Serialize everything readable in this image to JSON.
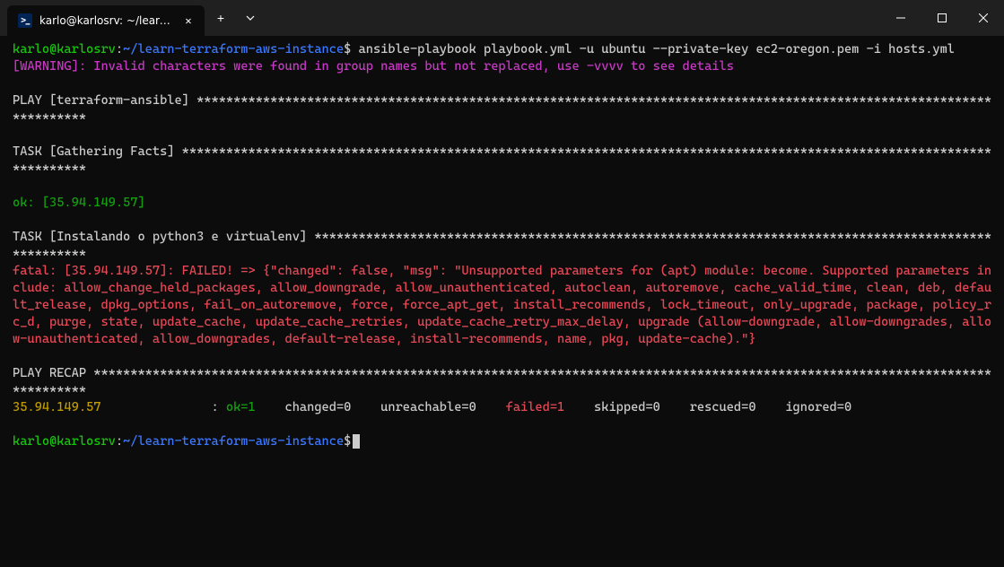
{
  "titlebar": {
    "tab_title": "karlo@karlosrv: ~/learn-terraf",
    "close_x": "✕",
    "plus": "+"
  },
  "prompt1": {
    "user_host": "karlo@karlosrv",
    "colon": ":",
    "path": "~/learn-terraform-aws-instance",
    "dollar": "$",
    "command": " ansible-playbook playbook.yml -u ubuntu --private-key ec2-oregon.pem -i hosts.yml"
  },
  "warning": {
    "tag": "[WARNING]",
    "msg": ": Invalid characters were found in group names but not replaced, use -vvvv to see details"
  },
  "play_header": "PLAY [terraform-ansible] ",
  "task1_header": "TASK [Gathering Facts] ",
  "ok_line": "ok: [35.94.149.57]",
  "task2_header": "TASK [Instalando o python3 e virtualenv] ",
  "fatal_msg": "fatal: [35.94.149.57]: FAILED! => {\"changed\": false, \"msg\": \"Unsupported parameters for (apt) module: become. Supported parameters include: allow_change_held_packages, allow_downgrade, allow_unauthenticated, autoclean, autoremove, cache_valid_time, clean, deb, default_release, dpkg_options, fail_on_autoremove, force, force_apt_get, install_recommends, lock_timeout, only_upgrade, package, policy_rc_d, purge, state, update_cache, update_cache_retries, update_cache_retry_max_delay, upgrade (allow-downgrade, allow-downgrades, allow-unauthenticated, allow_downgrades, default-release, install-recommends, name, pkg, update-cache).\"}",
  "recap_header": "PLAY RECAP ",
  "recap": {
    "host": "35.94.149.57",
    "pad": "               ",
    "colon": ": ",
    "ok": "ok=1",
    "sp1": "    ",
    "changed": "changed=0",
    "sp2": "    ",
    "unreachable": "unreachable=0",
    "sp3": "    ",
    "failed": "failed=1",
    "sp4": "    ",
    "skipped": "skipped=0",
    "sp5": "    ",
    "rescued": "rescued=0",
    "sp6": "    ",
    "ignored": "ignored=0"
  },
  "prompt2": {
    "user_host": "karlo@karlosrv",
    "colon": ":",
    "path": "~/learn-terraform-aws-instance",
    "dollar": "$"
  },
  "stars": {
    "play": "**********************************************************************************************************************",
    "task1": "************************************************************************************************************************",
    "task2": "******************************************************************************************************",
    "recap": "************************************************************************************************************************************"
  }
}
